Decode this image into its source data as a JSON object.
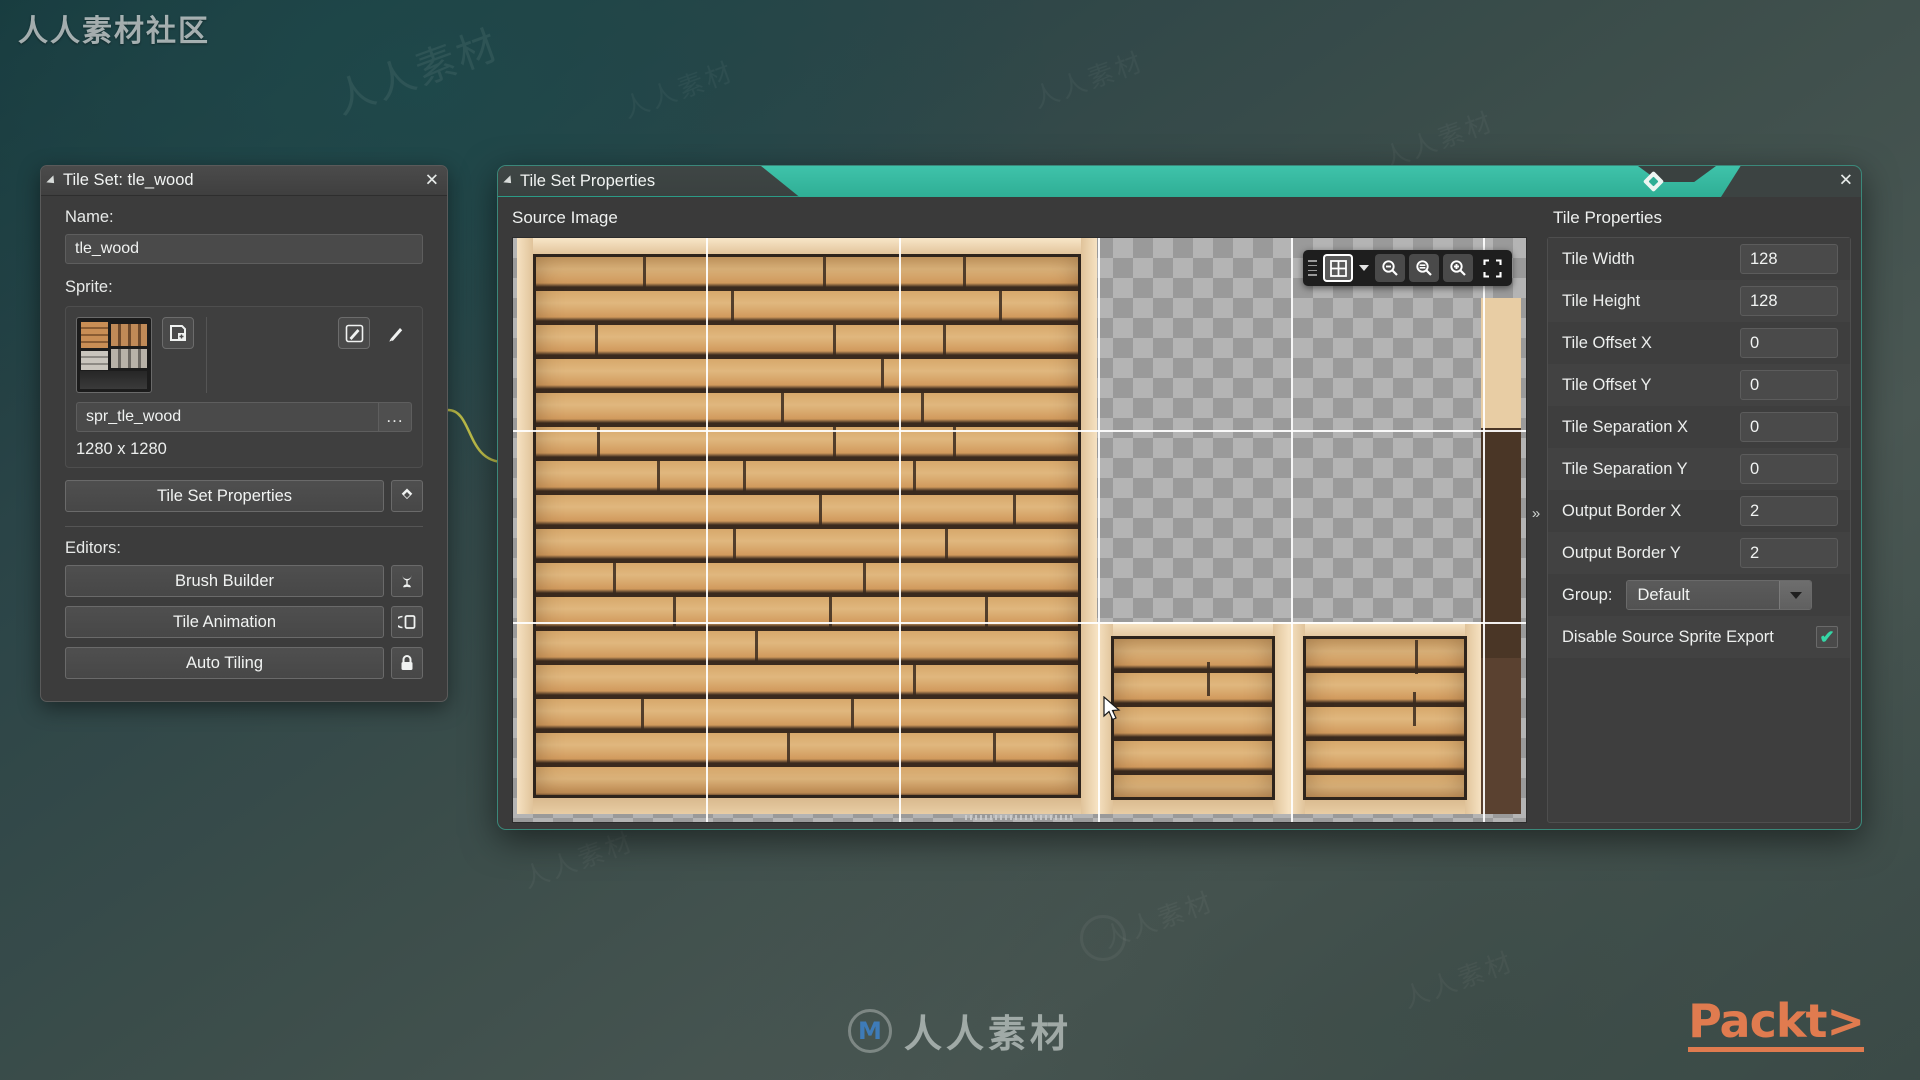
{
  "background": {
    "corner_brand": "人人素材社区",
    "watermark_text": "人人素材",
    "bottom_logo_letter": "M",
    "packt_logo": "Packt>",
    "accent_teal": "#2fae95",
    "panel_bg": "#3c3c3c",
    "packt_orange": "#e07b4f"
  },
  "tileset_panel": {
    "title": "Tile Set: tle_wood",
    "close_icon": "close-icon",
    "collapse_icon": "collapse-triangle-icon",
    "name_label": "Name:",
    "name_value": "tle_wood",
    "sprite_label": "Sprite:",
    "sprite_thumbnail_icon": "sprite-thumbnail",
    "new_sprite_icon": "new-sprite-icon",
    "edit_sprite_icon": "edit-sprite-icon",
    "paint_icon": "paintbrush-icon",
    "sprite_name": "spr_tle_wood",
    "browse_label": "...",
    "dimensions": "1280 x 1280",
    "properties_button": "Tile Set Properties",
    "properties_button_icon": "diamond-icon",
    "editors_label": "Editors:",
    "editors": [
      {
        "label": "Brush Builder",
        "icon": "tulip-brush-icon"
      },
      {
        "label": "Tile Animation",
        "icon": "animation-frames-icon"
      },
      {
        "label": "Auto Tiling",
        "icon": "lock-icon"
      }
    ]
  },
  "tsp_window": {
    "title": "Tile Set Properties",
    "collapse_icon": "collapse-triangle-icon",
    "close_icon": "close-icon",
    "pin_icon": "diamond-pin-icon",
    "source_image_label": "Source Image",
    "expand_icon": "chevron-right-double-icon",
    "toolbar": {
      "grid_toggle_icon": "grid-icon",
      "grid_dropdown_icon": "caret-down-icon",
      "zoom_out_icon": "zoom-out-icon",
      "zoom_reset_icon": "zoom-reset-icon",
      "zoom_in_icon": "zoom-in-icon",
      "fit_icon": "fit-to-screen-icon"
    },
    "cursor_icon": "mouse-pointer"
  },
  "tile_properties": {
    "title": "Tile Properties",
    "rows": [
      {
        "label": "Tile Width",
        "value": "128",
        "type": "number"
      },
      {
        "label": "Tile Height",
        "value": "128",
        "type": "number"
      },
      {
        "label": "Tile Offset X",
        "value": "0",
        "type": "number"
      },
      {
        "label": "Tile Offset Y",
        "value": "0",
        "type": "number"
      },
      {
        "label": "Tile Separation X",
        "value": "0",
        "type": "number"
      },
      {
        "label": "Tile Separation Y",
        "value": "0",
        "type": "number"
      },
      {
        "label": "Output Border X",
        "value": "2",
        "type": "number"
      },
      {
        "label": "Output Border Y",
        "value": "2",
        "type": "number"
      }
    ],
    "group_label": "Group:",
    "group_value": "Default",
    "group_caret_icon": "caret-down-icon",
    "disable_export_label": "Disable Source Sprite Export",
    "disable_export_checked": "✔"
  }
}
